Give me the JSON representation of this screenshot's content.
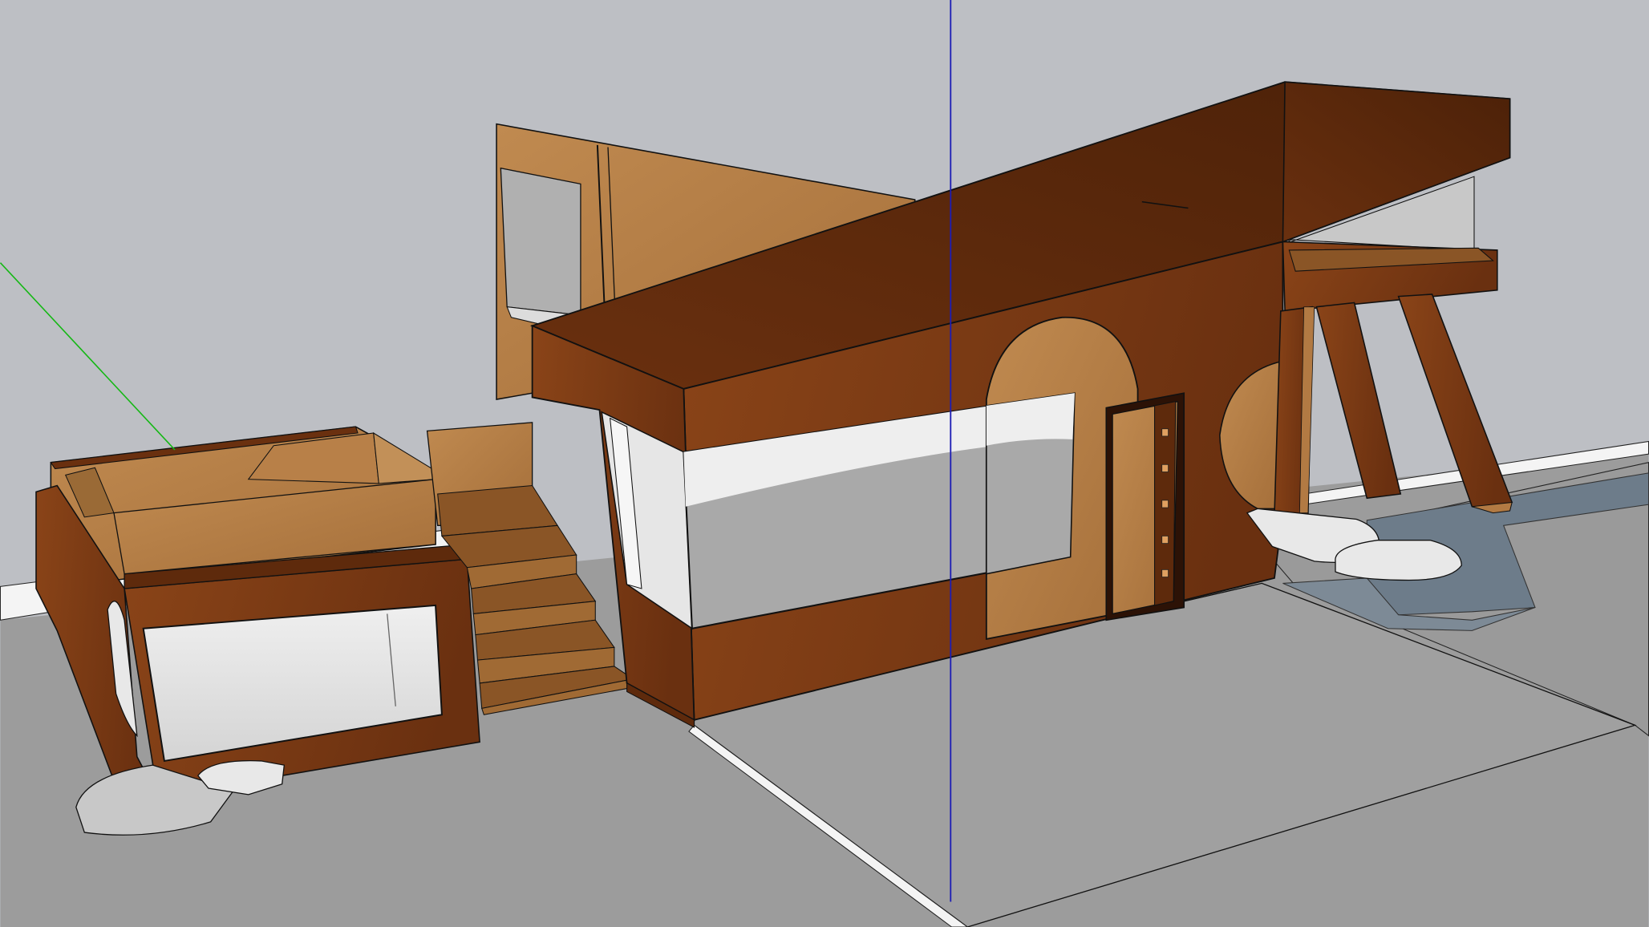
{
  "viewport": {
    "sky_color": "#bdbfc4",
    "ground_color": "#9c9c9c",
    "curb_color": "#f4f4f4",
    "dark_wood_color": "#7a3a14",
    "roof_wood_color": "#5e2a0c",
    "light_wood_color": "#b27a43",
    "stair_tread_color": "#8a5526",
    "glass_color": "#a9a9a9",
    "glass_light_color": "#dcdcdc",
    "water_color": "#6d7c8a",
    "outline_color": "#111111",
    "axis_colors": {
      "blue": "#1d1db5",
      "green": "#14b814"
    }
  }
}
